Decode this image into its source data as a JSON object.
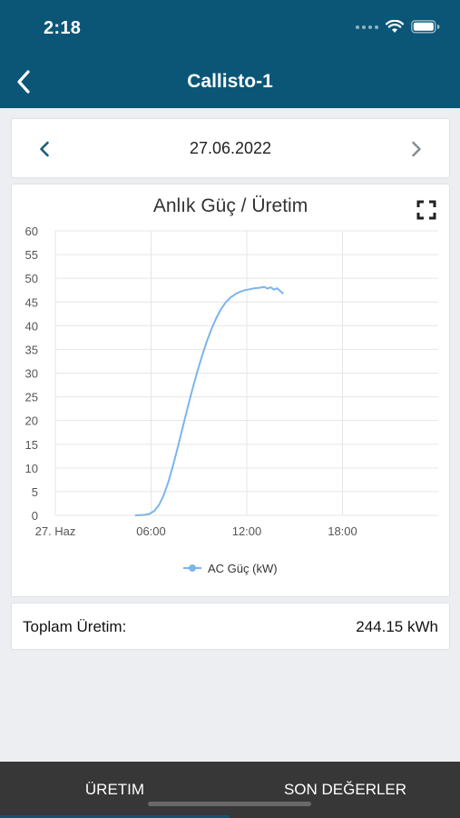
{
  "status_bar": {
    "time": "2:18"
  },
  "nav": {
    "title": "Callisto-1",
    "back_icon": "chevron-left-icon"
  },
  "date_nav": {
    "date": "27.06.2022",
    "prev_icon": "chevron-left-icon",
    "next_icon": "chevron-right-icon"
  },
  "chart": {
    "fullscreen_icon": "fullscreen-icon"
  },
  "chart_data": {
    "type": "line",
    "title": "Anlık Güç / Üretim",
    "ylim": [
      0,
      60
    ],
    "y_ticks": [
      "0",
      "5",
      "10",
      "15",
      "20",
      "25",
      "30",
      "35",
      "40",
      "45",
      "50",
      "55",
      "60"
    ],
    "x_ticks": [
      "27. Haz",
      "06:00",
      "12:00",
      "18:00"
    ],
    "xlim_hours": [
      0,
      24
    ],
    "grid": true,
    "legend_position": "bottom",
    "series": [
      {
        "name": "AC Güç (kW)",
        "color": "#7cb5ec",
        "points": [
          [
            5.0,
            0
          ],
          [
            5.6,
            0.1
          ],
          [
            5.9,
            0.3
          ],
          [
            6.2,
            0.9
          ],
          [
            6.5,
            2.2
          ],
          [
            6.8,
            4.3
          ],
          [
            7.1,
            7.2
          ],
          [
            7.4,
            10.8
          ],
          [
            7.7,
            14.7
          ],
          [
            8.0,
            18.8
          ],
          [
            8.3,
            22.8
          ],
          [
            8.6,
            26.7
          ],
          [
            8.9,
            30.3
          ],
          [
            9.2,
            33.7
          ],
          [
            9.5,
            36.7
          ],
          [
            9.8,
            39.4
          ],
          [
            10.1,
            41.7
          ],
          [
            10.4,
            43.6
          ],
          [
            10.7,
            45.0
          ],
          [
            11.0,
            46.0
          ],
          [
            11.3,
            46.7
          ],
          [
            11.6,
            47.2
          ],
          [
            11.9,
            47.5
          ],
          [
            12.2,
            47.7
          ],
          [
            12.5,
            47.9
          ],
          [
            12.8,
            48.0
          ],
          [
            13.1,
            48.2
          ],
          [
            13.3,
            47.8
          ],
          [
            13.5,
            48.1
          ],
          [
            13.7,
            47.6
          ],
          [
            13.9,
            47.9
          ],
          [
            14.1,
            47.3
          ],
          [
            14.3,
            46.7
          ]
        ]
      }
    ]
  },
  "summary": {
    "label": "Toplam Üretim:",
    "value": "244.15 kWh"
  },
  "tabs": [
    {
      "label": "ÜRETIM",
      "active": true
    },
    {
      "label": "SON DEĞERLER",
      "active": false
    }
  ],
  "colors": {
    "header": "#0b5677",
    "tab_bar": "#373737",
    "series": "#7cb5ec",
    "grid": "#e6e6e6"
  }
}
